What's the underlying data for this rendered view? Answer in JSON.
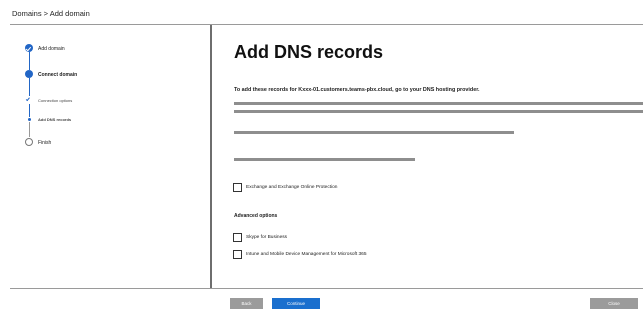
{
  "breadcrumb": "Domains > Add domain",
  "steps": {
    "add_domain": "Add domain",
    "connect_domain": "Connect domain",
    "connection_options": "Connection options",
    "add_dns_records": "Add DNS records",
    "finish": "Finish"
  },
  "main": {
    "title": "Add DNS records",
    "description": "To add these records for Kxxx-01.customers.teams-pbx.cloud, go to your DNS hosting provider."
  },
  "options": {
    "exchange": "Exchange and Exchange Online Protection",
    "advanced_heading": "Advanced options",
    "skype": "Skype for Business",
    "intune": "Intune and Mobile Device Management for Microsoft 365"
  },
  "footer": {
    "back": "Back",
    "continue": "Continue",
    "close": "Close"
  },
  "colors": {
    "accent": "#1a6fce",
    "disabled_button": "#9b9b9b",
    "placeholder_bar": "#8e8e8e"
  }
}
